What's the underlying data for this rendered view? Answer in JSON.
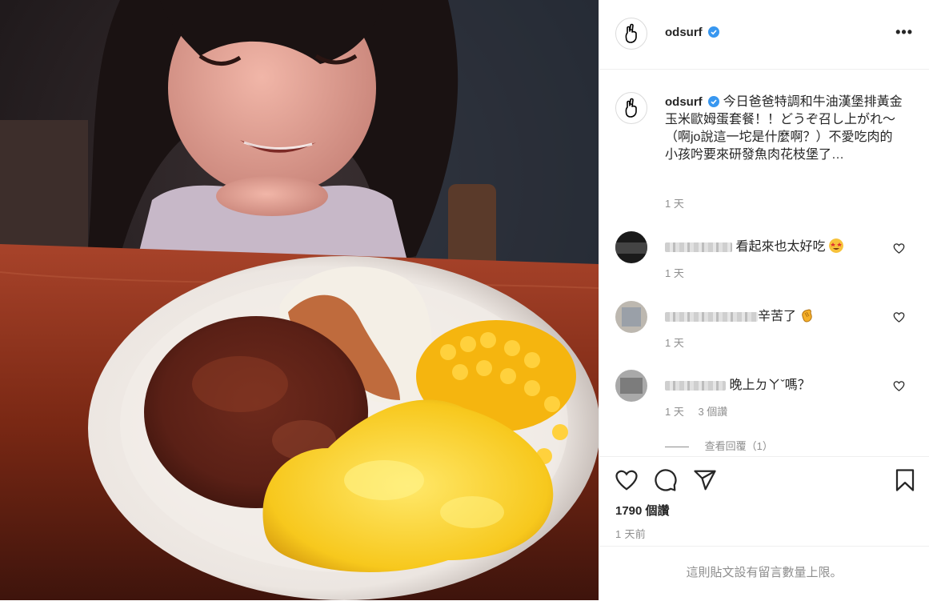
{
  "post": {
    "username": "odsurf",
    "more_label": "•••",
    "caption": "今日爸爸特調和牛油漢堡排黃金玉米歐姆蛋套餐！！どうぞ召し上がれ～（啊jo說這一坨是什麼啊？）不愛吃肉的小孩𠯋要來研發魚肉花枝堡了…",
    "caption_time": "1 天",
    "comments": [
      {
        "text": "看起來也太好吃",
        "emoji": "star-struck-emoji",
        "time": "1 天"
      },
      {
        "text": "辛苦了",
        "emoji": "clap-emoji",
        "time": "1 天"
      },
      {
        "text": "晚上ㄉㄚˇ嗎？",
        "emoji": "",
        "time": "1 天",
        "likes": "3 個讚",
        "view_replies": "查看回覆（1）"
      }
    ],
    "likes_count": "1790 個讚",
    "posted_time": "1 天前",
    "comment_limit_notice": "這則貼文設有留言數量上限。"
  },
  "colors": {
    "verified": "#3897f0",
    "text": "#262626",
    "muted": "#8e8e8e",
    "divider": "#efefef"
  },
  "icons": [
    "crossed-fingers-avatar-icon",
    "verified-badge-icon",
    "more-options-icon",
    "heart-icon",
    "comment-icon",
    "share-icon",
    "bookmark-icon"
  ]
}
